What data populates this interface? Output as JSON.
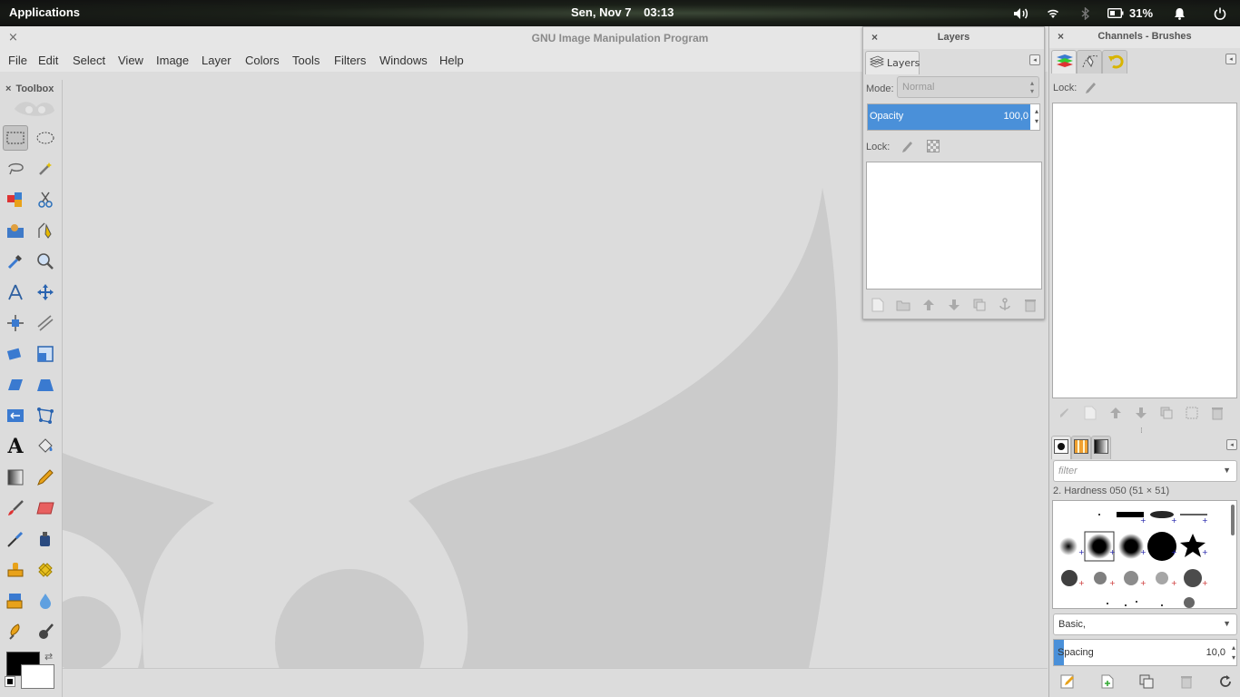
{
  "topbar": {
    "applications": "Applications",
    "date": "Sen, Nov  7",
    "time": "03:13",
    "battery": "31%",
    "icons": [
      "volume-icon",
      "wifi-icon",
      "bluetooth-icon",
      "battery-icon",
      "notification-bell-icon",
      "power-icon"
    ]
  },
  "window": {
    "title": "GNU Image Manipulation Program",
    "close": "×"
  },
  "menu": [
    "File",
    "Edit",
    "Select",
    "View",
    "Image",
    "Layer",
    "Colors",
    "Tools",
    "Filters",
    "Windows",
    "Help"
  ],
  "toolbox": {
    "title": "Toolbox",
    "close": "×",
    "tools": [
      "rect-select",
      "ellipse-select",
      "free-select",
      "fuzzy-select",
      "select-by-color",
      "scissors-select",
      "foreground-select",
      "paths",
      "color-picker",
      "zoom",
      "measure",
      "move",
      "align",
      "crop",
      "rotate",
      "scale",
      "shear",
      "perspective",
      "flip",
      "cage-transform",
      "text",
      "bucket-fill",
      "blend",
      "pencil",
      "paintbrush",
      "eraser",
      "airbrush",
      "ink",
      "clone",
      "heal",
      "perspective-clone",
      "blur-sharpen",
      "smudge",
      "dodge-burn"
    ],
    "fg_color": "#000000",
    "bg_color": "#ffffff"
  },
  "layers": {
    "title": "Layers",
    "close": "×",
    "tab": "Layers",
    "mode_label": "Mode:",
    "mode_value": "Normal",
    "opacity_label": "Opacity",
    "opacity_value": "100,0",
    "lock_label": "Lock:",
    "buttons": [
      "new-layer",
      "new-layer-group",
      "raise-layer",
      "lower-layer",
      "duplicate-layer",
      "anchor-layer",
      "delete-layer"
    ]
  },
  "channels": {
    "title": "Channels - Brushes",
    "close": "×",
    "tabs": [
      "layers-tab",
      "paths-tab",
      "undo-tab"
    ],
    "lock_label": "Lock:"
  },
  "brushes": {
    "filter_placeholder": "filter",
    "selected": "2. Hardness 050 (51 × 51)",
    "preset": "Basic,",
    "spacing_label": "Spacing",
    "spacing_value": "10,0",
    "accent": "#4a90d9"
  }
}
